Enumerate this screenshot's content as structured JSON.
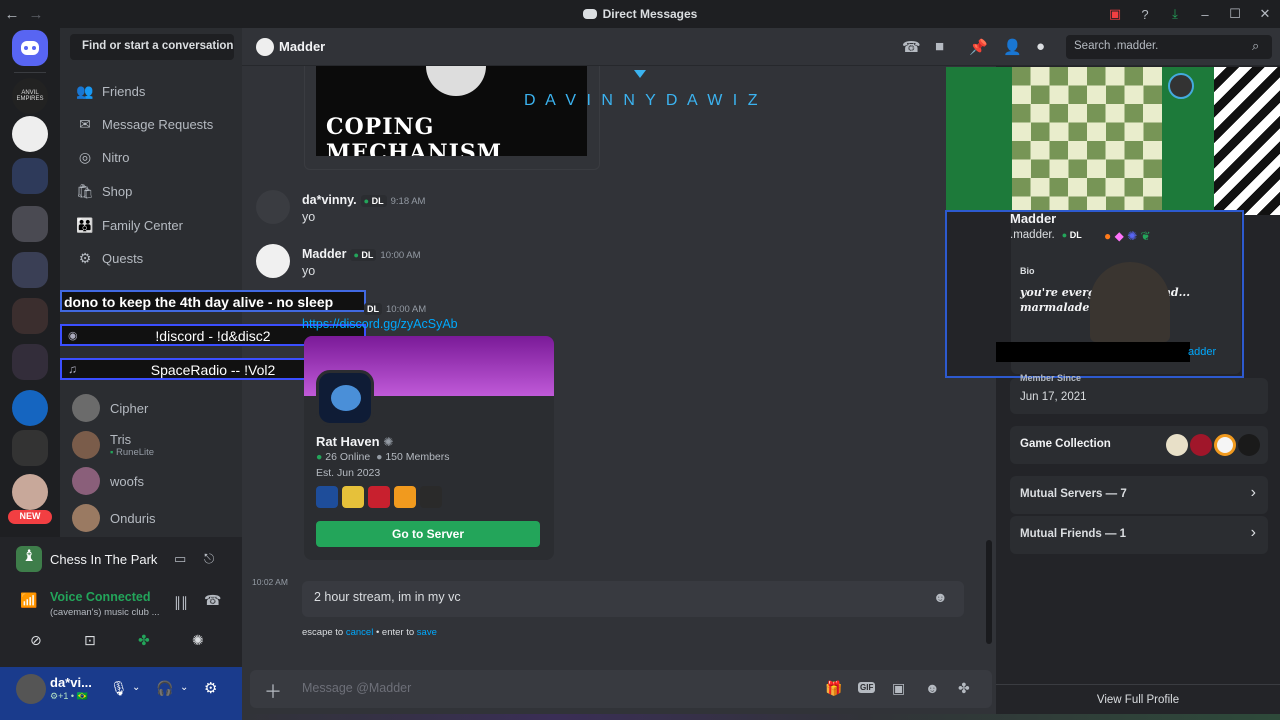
{
  "window": {
    "title": "Direct Messages",
    "back": "←",
    "forward": "→",
    "controls": [
      "▣",
      "?",
      "⤓",
      "–",
      "☐",
      "✕"
    ]
  },
  "sidebar": {
    "find_placeholder": "Find or start a conversation",
    "nav": [
      {
        "label": "Friends",
        "icon": "friends-icon"
      },
      {
        "label": "Message Requests",
        "icon": "mail-icon"
      },
      {
        "label": "Nitro",
        "icon": "nitro-icon"
      },
      {
        "label": "Shop",
        "icon": "shop-icon"
      },
      {
        "label": "Family Center",
        "icon": "family-icon"
      },
      {
        "label": "Quests",
        "icon": "quests-icon"
      }
    ],
    "dms": [
      {
        "name": "Cipher",
        "sub": ""
      },
      {
        "name": "Tris",
        "sub": "RuneLite"
      },
      {
        "name": "woofs",
        "sub": ""
      },
      {
        "name": "Onduris",
        "sub": ""
      }
    ],
    "rail_labels": [
      "ANVIL EMPIRES",
      "NEW"
    ]
  },
  "overlays": {
    "line1": "dono to keep the 4th day alive - no sleep",
    "line2": "!discord   -   !d&disc2",
    "line3": "SpaceRadio  --  !Vol2"
  },
  "voice": {
    "activity": "Chess In The Park",
    "status": "Voice Connected",
    "channel": "(caveman's) music club ..."
  },
  "user": {
    "name": "da*vi...",
    "sub": "⚙+1 • 🇧🇷"
  },
  "header": {
    "title": "Madder",
    "search_placeholder": "Search .madder."
  },
  "messages": {
    "image_caption": "COPING MECHANISM",
    "stream_overlay": "D A V I N N Y D A W I Z",
    "m1": {
      "author": "da*vinny.",
      "tag": "DL",
      "time": "9:18 AM",
      "text": "yo"
    },
    "m2": {
      "author": "Madder",
      "tag": "DL",
      "time": "10:00 AM",
      "text": "yo"
    },
    "m3": {
      "tag": "DL",
      "time": "10:00 AM",
      "link": "https://discord.gg/zyAcSyAb"
    },
    "invite": {
      "name": "Rat Haven",
      "online": "26 Online",
      "members": "150 Members",
      "est": "Est. Jun 2023",
      "button": "Go to Server"
    },
    "edit": {
      "time": "10:02 AM",
      "text": "2 hour stream, im in my vc",
      "hint_pre": "escape to",
      "hint_cancel": "cancel",
      "hint_mid": "• enter to",
      "hint_save": "save"
    }
  },
  "composer": {
    "placeholder": "Message @Madder",
    "gif": "GIF"
  },
  "profile": {
    "name": "Madder",
    "handle": ".madder.",
    "tag": "DL",
    "bio_label": "Bio",
    "bio_text": "you're everg... your brand... marmalade tanger...",
    "link_fragment": "adder",
    "member_since_label": "Member Since",
    "member_since": "Jun 17, 2021",
    "game_collection": "Game Collection",
    "mutual_servers": "Mutual Servers — 7",
    "mutual_friends": "Mutual Friends — 1",
    "view_full": "View Full Profile"
  },
  "colors": {
    "accent": "#5865f2",
    "online": "#23a55a",
    "link": "#00a8fc",
    "voice_green": "#23a55a"
  }
}
